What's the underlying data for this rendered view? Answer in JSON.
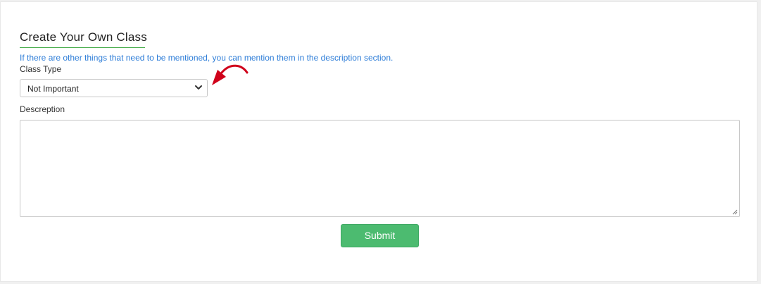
{
  "form": {
    "title": "Create Your Own Class",
    "note": "If there are other things that need to be mentioned, you can mention them in the description section.",
    "class_type_label": "Class Type",
    "class_type_value": "Not Important",
    "description_label": "Descreption",
    "description_value": "",
    "submit_label": "Submit"
  },
  "icons": {
    "select_chevron": "chevron-down-icon",
    "annotation_arrow": "curved-arrow-icon",
    "resize_grip": "resize-grip-icon"
  },
  "colors": {
    "accent_green": "#4cbb70",
    "underline_green": "#4caf50",
    "note_blue": "#2f7ed8",
    "arrow_red": "#d0021b"
  }
}
